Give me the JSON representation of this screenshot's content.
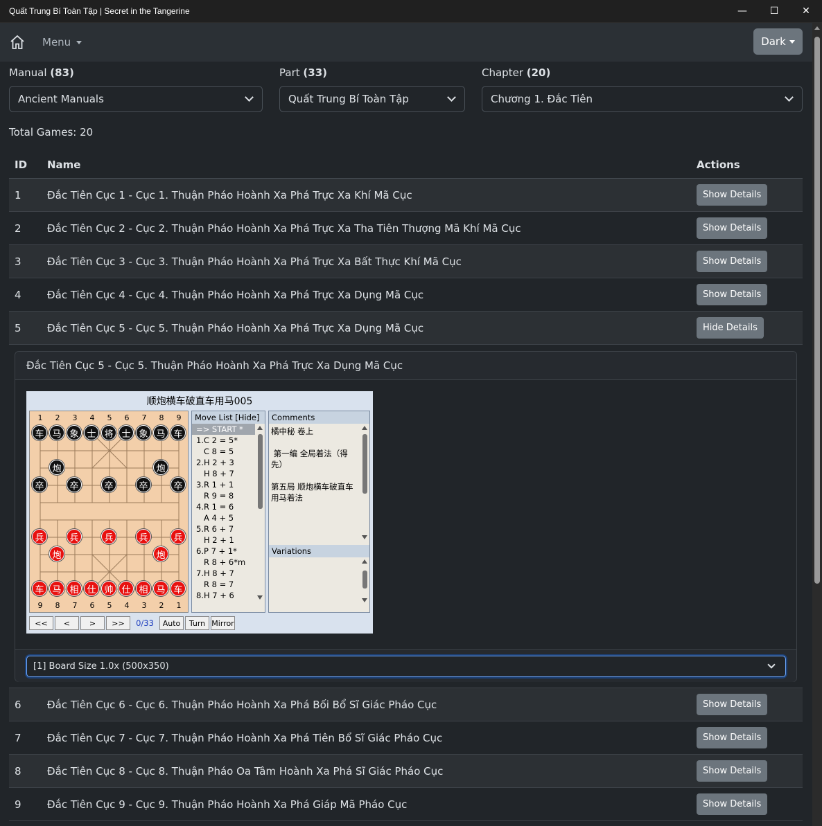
{
  "window": {
    "title": "Quất Trung Bí Toàn Tập | Secret in the Tangerine",
    "minimize": "—",
    "maximize": "☐",
    "close": "✕"
  },
  "navbar": {
    "menu_label": "Menu",
    "theme_label": "Dark"
  },
  "filters": {
    "manual": {
      "label": "Manual",
      "count": "(83)",
      "value": "Ancient Manuals"
    },
    "part": {
      "label": "Part",
      "count": "(33)",
      "value": "Quất Trung Bí Toàn Tập"
    },
    "chapter": {
      "label": "Chapter",
      "count": "(20)",
      "value": "Chương 1. Đắc Tiên"
    }
  },
  "total": "Total Games: 20",
  "table": {
    "headers": {
      "id": "ID",
      "name": "Name",
      "actions": "Actions"
    },
    "rows_top": [
      {
        "id": "1",
        "name": "Đắc Tiên Cục 1 - Cục 1. Thuận Pháo Hoành Xa Phá Trực Xa Khí Mã Cục",
        "action": "Show Details"
      },
      {
        "id": "2",
        "name": "Đắc Tiên Cục 2 - Cục 2. Thuận Pháo Hoành Xa Phá Trực Xa Tha Tiên Thượng Mã Khí Mã Cục",
        "action": "Show Details"
      },
      {
        "id": "3",
        "name": "Đắc Tiên Cục 3 - Cục 3. Thuận Pháo Hoành Xa Phá Trực Xa Bất Thực Khí Mã Cục",
        "action": "Show Details"
      },
      {
        "id": "4",
        "name": "Đắc Tiên Cục 4 - Cục 4. Thuận Pháo Hoành Xa Phá Trực Xa Dụng Mã Cục",
        "action": "Show Details"
      },
      {
        "id": "5",
        "name": "Đắc Tiên Cục 5 - Cục 5. Thuận Pháo Hoành Xa Phá Trực Xa Dụng Mã Cục",
        "action": "Hide Details"
      }
    ],
    "rows_bottom": [
      {
        "id": "6",
        "name": "Đắc Tiên Cục 6 - Cục 6. Thuận Pháo Hoành Xa Phá Bối Bổ Sĩ Giác Pháo Cục",
        "action": "Show Details"
      },
      {
        "id": "7",
        "name": "Đắc Tiên Cục 7 - Cục 7. Thuận Pháo Hoành Xa Phá Tiên Bổ Sĩ Giác Pháo Cục",
        "action": "Show Details"
      },
      {
        "id": "8",
        "name": "Đắc Tiên Cục 8 - Cục 8. Thuận Pháo Oa Tâm Hoành Xa Phá Sĩ Giác Pháo Cục",
        "action": "Show Details"
      },
      {
        "id": "9",
        "name": "Đắc Tiên Cục 9 - Cục 9. Thuận Pháo Hoành Xa Phá Giáp Mã Pháo Cục",
        "action": "Show Details"
      }
    ]
  },
  "detail": {
    "header": "Đắc Tiên Cục 5 - Cục 5. Thuận Pháo Hoành Xa Phá Trực Xa Dụng Mã Cục",
    "board_size": "[1] Board Size 1.0x (500x350)",
    "xq": {
      "title": "顺炮横车破直车用马005",
      "top_numbers": [
        "1",
        "2",
        "3",
        "4",
        "5",
        "6",
        "7",
        "8",
        "9"
      ],
      "bottom_numbers": [
        "9",
        "8",
        "7",
        "6",
        "5",
        "4",
        "3",
        "2",
        "1"
      ],
      "black_back": [
        "车",
        "马",
        "象",
        "士",
        "将",
        "士",
        "象",
        "马",
        "车"
      ],
      "black_cannon": "炮",
      "black_pawn": "卒",
      "red_back": [
        "车",
        "马",
        "相",
        "仕",
        "帅",
        "仕",
        "相",
        "马",
        "车"
      ],
      "red_cannon": "炮",
      "red_pawn": "兵",
      "move_list_header": "Move List [Hide]",
      "moves": [
        "=> START *",
        "1.C 2 = 5*",
        "   C 8 = 5",
        "2.H 2 + 3",
        "   H 8 + 7",
        "3.R 1 + 1",
        "   R 9 = 8",
        "4.R 1 = 6",
        "   A 4 + 5",
        "5.R 6 + 7",
        "   H 2 + 1",
        "6.P 7 + 1*",
        "   R 8 + 6*m",
        "7.H 8 + 7",
        "   R 8 = 7",
        "8.H 7 + 6"
      ],
      "comments_header": "Comments",
      "comments": "橘中秘 卷上\n\n 第一编 全局着法（得先）\n\n第五局 顺炮横车破直车用马着法",
      "variations_header": "Variations",
      "controls": {
        "first": "<<",
        "prev": "<",
        "next": ">",
        "last": ">>",
        "counter": "0/33",
        "auto": "Auto",
        "turn": "Turn",
        "mirror": "Mirror"
      }
    }
  },
  "colors": {
    "accent": "#6c757d",
    "red_piece": "#e8110f",
    "black_piece": "#111111",
    "board": "#f3cfaa"
  }
}
